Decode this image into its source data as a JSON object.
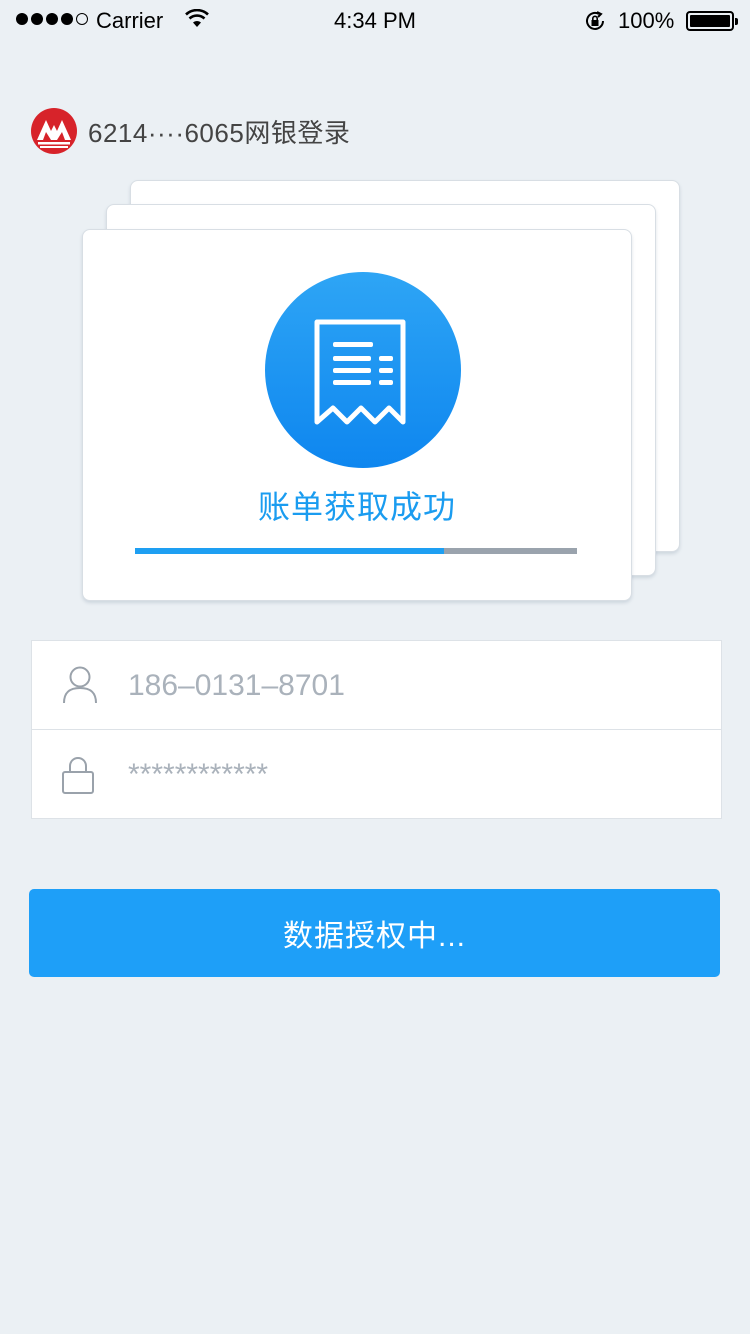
{
  "status_bar": {
    "carrier": "Carrier",
    "time": "4:34 PM",
    "battery": "100%"
  },
  "bank": {
    "title": "6214····6065网银登录",
    "logo_icon": "china-merchants-bank-logo",
    "brand_color": "#d7232a"
  },
  "card": {
    "icon": "receipt-icon",
    "status_text": "账单获取成功",
    "progress": 0.7
  },
  "form": {
    "account": {
      "icon": "user-icon",
      "value": "186–0131–8701"
    },
    "password": {
      "icon": "lock-icon",
      "value": "************"
    }
  },
  "button": {
    "label": "数据授权中..."
  },
  "colors": {
    "accent": "#1e9ff8",
    "background": "#ebf0f4"
  }
}
